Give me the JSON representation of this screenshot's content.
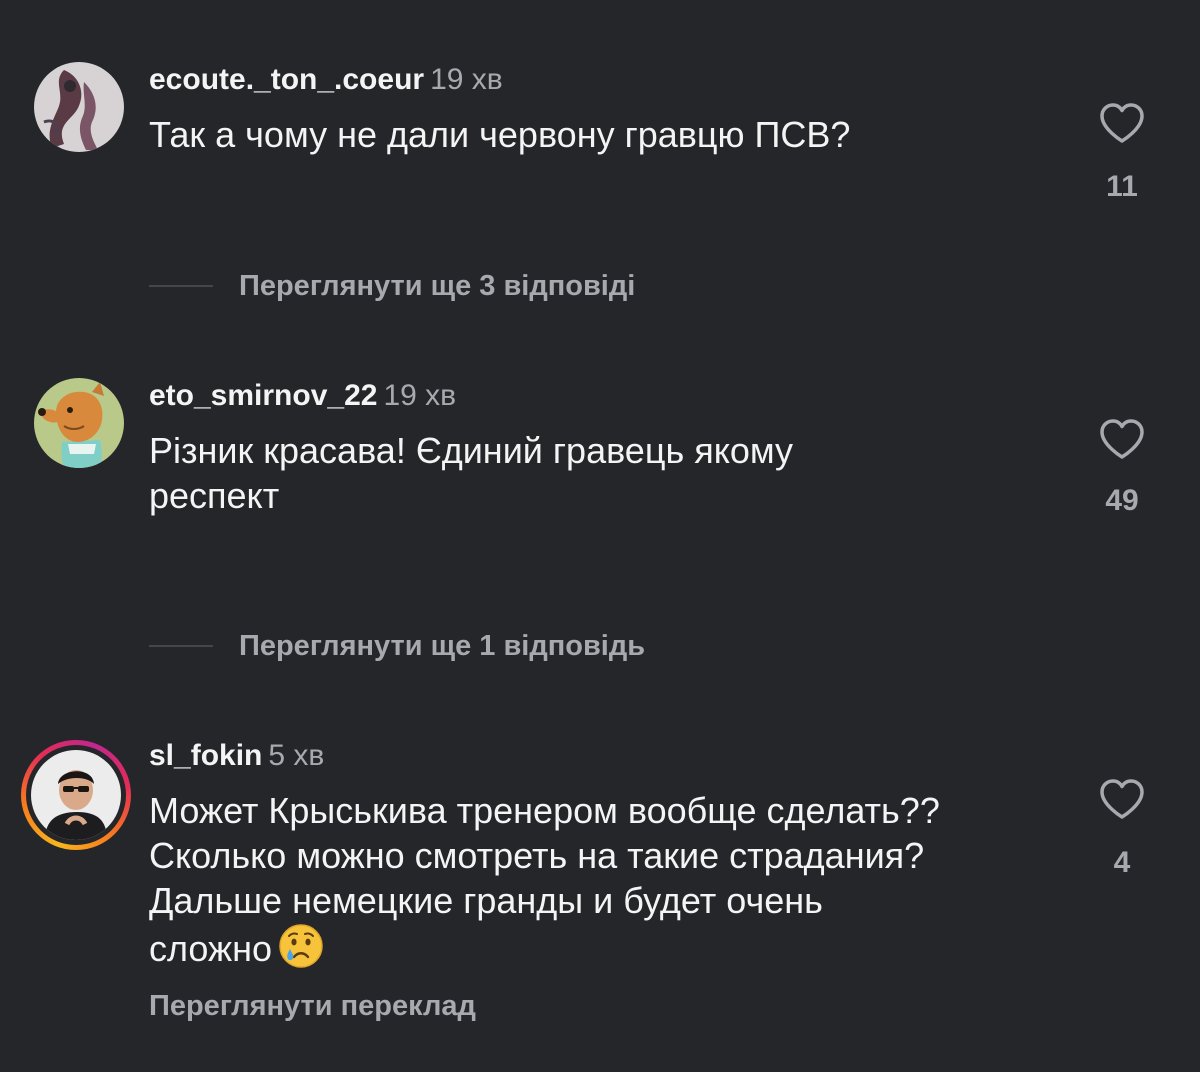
{
  "comments": [
    {
      "username": "ecoute._ton_.coeur",
      "time": "19 хв",
      "text": "Так а чому не дали червону гравцю ПСВ?",
      "likes": "11",
      "view_replies": "Переглянути ще 3 відповіді"
    },
    {
      "username": "eto_smirnov_22",
      "time": "19 хв",
      "text_line1": "Різник красава! Єдиний гравець якому",
      "text_line2": "респект",
      "likes": "49",
      "view_replies": "Переглянути ще 1 відповідь"
    },
    {
      "username": "sl_fokin",
      "time": "5 хв",
      "text_line1": "Может Крыськива тренером вообще сделать??",
      "text_line2": "Сколько можно смотреть на такие страдания?",
      "text_line3": "Дальше немецкие гранды и будет очень",
      "text_line4": "сложно",
      "emoji": "crying-face",
      "likes": "4",
      "translate": "Переглянути переклад"
    }
  ],
  "icons": {
    "like": "heart-outline-icon"
  },
  "colors": {
    "background": "#25262a",
    "primary_text": "#f4f4f5",
    "secondary_text": "#a8a9ae",
    "story_ring": [
      "#f7b51e",
      "#e32c58",
      "#c0278f"
    ]
  }
}
